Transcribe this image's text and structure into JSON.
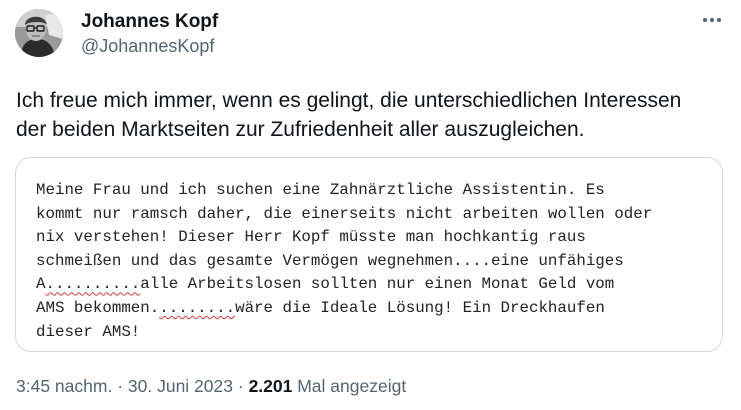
{
  "author": {
    "name": "Johannes Kopf",
    "handle": "@JohannesKopf"
  },
  "tweet": {
    "text_lines": [
      "Ich freue mich immer, wenn es gelingt, die unterschiedlichen Interessen",
      "der beiden Marktseiten zur Zufriedenheit aller auszugleichen."
    ]
  },
  "quoted_card": {
    "lines": [
      "Meine Frau und ich suchen eine Zahnärztliche Assistentin. Es",
      "kommt nur ramsch daher, die einerseits nicht arbeiten wollen oder",
      "nix verstehen! Dieser Herr Kopf müsste man hochkantig raus",
      "schmeißen und das gesamte Vermögen wegnehmen....eine unfähiges",
      "alle Arbeitslosen sollten nur einen Monat Geld vom",
      "wäre die Ideale Lösung! Ein Dreckhaufen",
      "dieser AMS!"
    ],
    "line5_prefix": "A",
    "line5_squiggle": "..........",
    "line6_prefix": "AMS bekommen.",
    "line6_squiggle": "........",
    "spellcheck_color": "#d83a3a"
  },
  "meta": {
    "time": "3:45 nachm.",
    "separator": "·",
    "date": "30. Juni 2023",
    "views_count": "2.201",
    "views_label": "Mal angezeigt"
  },
  "icons": {
    "more": "more-horizontal-icon",
    "avatar": "profile-photo"
  },
  "colors": {
    "text_primary": "#0f1419",
    "text_secondary": "#536471",
    "card_border": "#cfd9de"
  }
}
